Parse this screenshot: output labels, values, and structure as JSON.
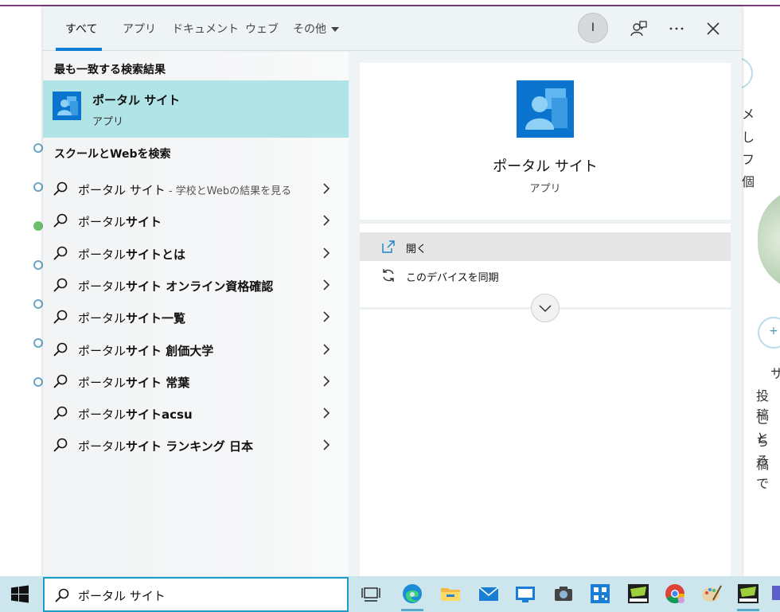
{
  "background": {
    "side_chars": [
      "メ",
      "し",
      "フ",
      "個"
    ],
    "paragraph_lines": [
      "サ",
      "投稿",
      "こと",
      "ちろ",
      "稿で"
    ],
    "plus_glyph": "+"
  },
  "tabs": [
    {
      "label": "すべて",
      "active": true
    },
    {
      "label": "アプリ",
      "active": false
    },
    {
      "label": "ドキュメント",
      "active": false
    },
    {
      "label": "ウェブ",
      "active": false
    },
    {
      "label": "その他",
      "active": false
    }
  ],
  "user_avatar": "I",
  "top_icons": [
    "feedback-icon",
    "more-icon",
    "close-icon"
  ],
  "best_match": {
    "header": "最も一致する検索結果",
    "title": "ポータル サイト",
    "subtitle": "アプリ"
  },
  "web_section": {
    "header": "スクールとWebを検索",
    "suggestions": [
      {
        "prefix": "ポータル サイト",
        "suffix": "",
        "hint": " - 学校とWebの結果を見る"
      },
      {
        "prefix": "ポータル",
        "suffix": "サイト",
        "hint": ""
      },
      {
        "prefix": "ポータル",
        "suffix": "サイトとは",
        "hint": ""
      },
      {
        "prefix": "ポータル",
        "suffix": "サイト オンライン資格確認",
        "hint": ""
      },
      {
        "prefix": "ポータル",
        "suffix": "サイト一覧",
        "hint": ""
      },
      {
        "prefix": "ポータル",
        "suffix": "サイト 創価大学",
        "hint": ""
      },
      {
        "prefix": "ポータル",
        "suffix": "サイト 常葉",
        "hint": ""
      },
      {
        "prefix": "ポータル",
        "suffix": "サイトacsu",
        "hint": ""
      },
      {
        "prefix": "ポータル",
        "suffix": "サイト ランキング 日本",
        "hint": ""
      }
    ]
  },
  "preview": {
    "title": "ポータル サイト",
    "subtitle": "アプリ",
    "actions": [
      {
        "label": "開く",
        "icon": "open-icon"
      },
      {
        "label": "このデバイスを同期",
        "icon": "sync-icon"
      }
    ]
  },
  "taskbar": {
    "search_value": "ポータル サイト",
    "apps": [
      "task-view-icon",
      "edge-icon",
      "file-explorer-icon",
      "mail-icon",
      "remote-desktop-icon",
      "camera-icon",
      "qr-icon",
      "school-app-icon",
      "chrome-icon",
      "paint-icon",
      "school-app-2-icon",
      "teams-icon"
    ]
  },
  "colors": {
    "accent": "#0a7fd6",
    "best_match_bg": "#b1e4e6",
    "app_tile": "#0a74cf",
    "taskbar": "#cde6ee"
  }
}
